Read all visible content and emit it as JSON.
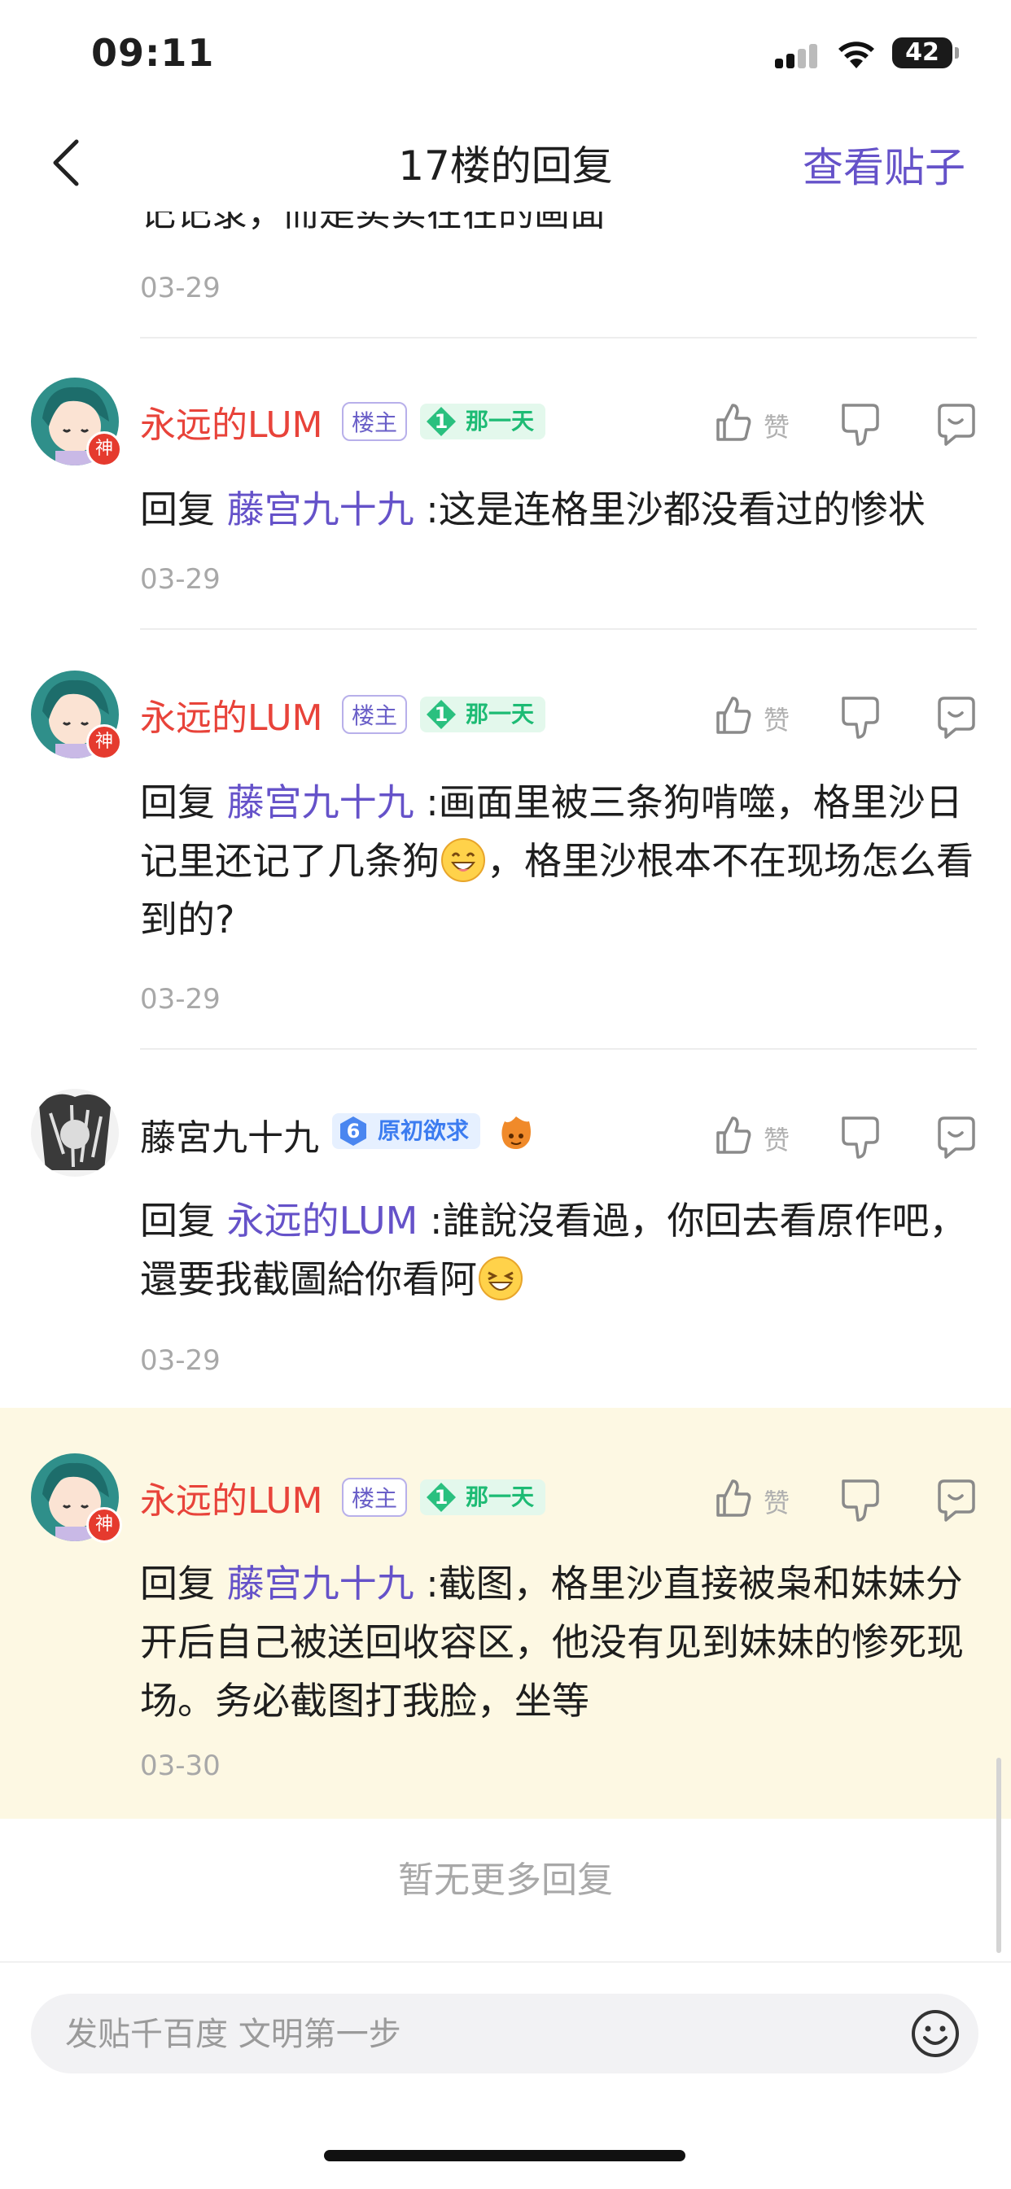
{
  "status_bar": {
    "time": "09:11",
    "battery": "42"
  },
  "nav": {
    "title": "17楼的回复",
    "view_post": "查看贴子"
  },
  "top_clip": {
    "text": "记记录，而是实实在在的画面",
    "date": "03-29"
  },
  "common": {
    "owner_tag": "楼主",
    "like_label": "赞"
  },
  "replies": [
    {
      "username": "永远的LUM",
      "level": "1",
      "title": "那一天",
      "prefix": "回复 ",
      "mention": "藤宫九十九",
      "text": " :这是连格里沙都没看过的惨状",
      "date": "03-29"
    },
    {
      "username": "永远的LUM",
      "level": "1",
      "title": "那一天",
      "prefix": "回复 ",
      "mention": "藤宫九十九",
      "text_a": " :画面里被三条狗啃噬，格里沙日记里还记了几条狗",
      "text_b": "，格里沙根本不在现场怎么看到的?",
      "date": "03-29"
    },
    {
      "username": "藤宮九十九",
      "level": "6",
      "title": "原初欲求",
      "prefix": "回复 ",
      "mention": "永远的LUM",
      "text_a": " :誰說沒看過，你回去看原作吧，還要我截圖給你看阿",
      "date": "03-29"
    },
    {
      "username": "永远的LUM",
      "level": "1",
      "title": "那一天",
      "prefix": "回复 ",
      "mention": "藤宫九十九",
      "text": " :截图，格里沙直接被枭和妹妹分开后自己被送回收容区，他没有见到妹妹的惨死现场。务必截图打我脸，坐等",
      "date": "03-30"
    }
  ],
  "no_more": "暂无更多回复",
  "composer": {
    "placeholder": "发贴千百度 文明第一步"
  },
  "colors": {
    "accent": "#6552c9",
    "username_red": "#e8433a",
    "highlight_bg": "#fdf8e3"
  }
}
